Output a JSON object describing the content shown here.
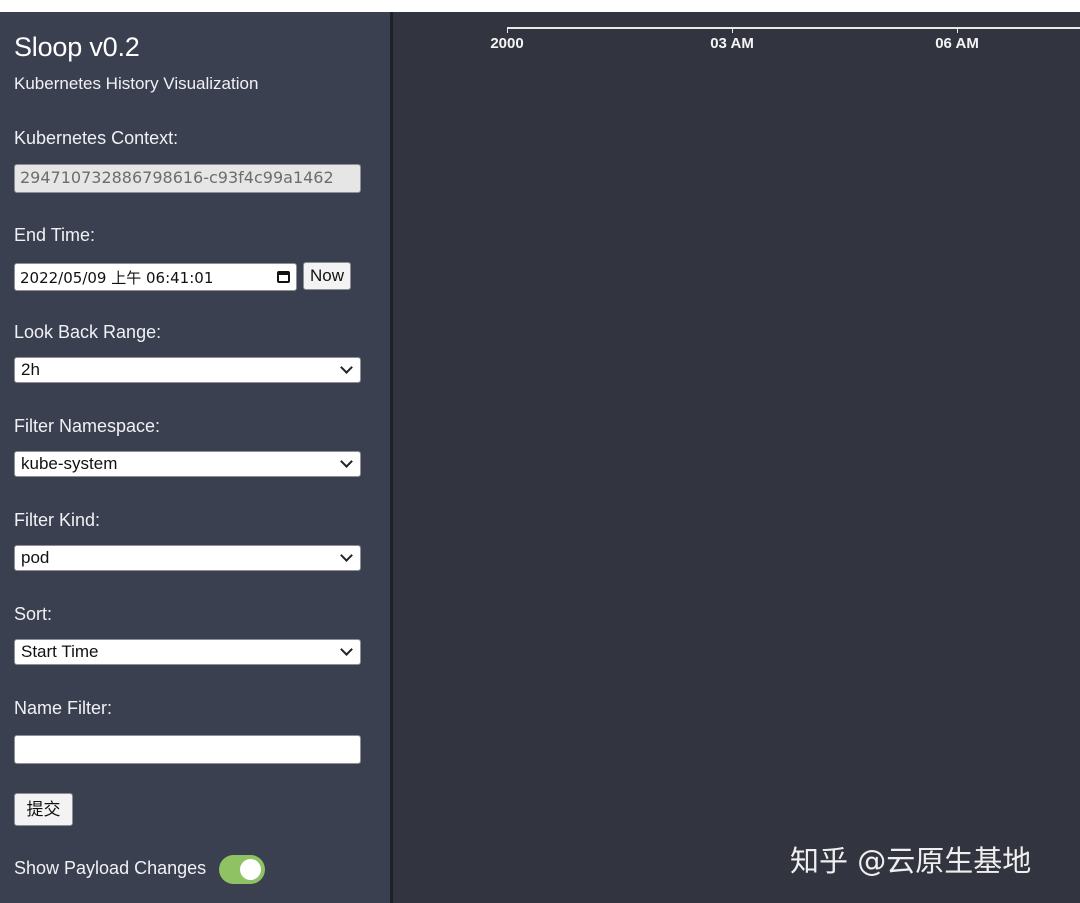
{
  "sidebar": {
    "title": "Sloop v0.2",
    "subtitle": "Kubernetes History Visualization",
    "context": {
      "label": "Kubernetes Context:",
      "value": "294710732886798616-c93f4c99a1462"
    },
    "end_time": {
      "label": "End Time:",
      "value": "2022/05/09 上午 06:41:01",
      "now_button": "Now",
      "calendar_icon": "calendar-icon"
    },
    "look_back": {
      "label": "Look Back Range:",
      "selected": "2h"
    },
    "namespace": {
      "label": "Filter Namespace:",
      "selected": "kube-system"
    },
    "kind": {
      "label": "Filter Kind:",
      "selected": "pod"
    },
    "sort": {
      "label": "Sort:",
      "selected": "Start Time"
    },
    "name_filter": {
      "label": "Name Filter:",
      "value": ""
    },
    "submit_label": "提交",
    "payload_toggle": {
      "label": "Show Payload Changes",
      "on": true,
      "color": "#8fc262"
    }
  },
  "timeline": {
    "ticks": [
      "2000",
      "03 AM",
      "06 AM"
    ]
  },
  "watermark": {
    "text": "知乎 @云原生基地"
  },
  "colors": {
    "sidebar_bg": "#3b4051",
    "main_bg": "#32353f"
  }
}
